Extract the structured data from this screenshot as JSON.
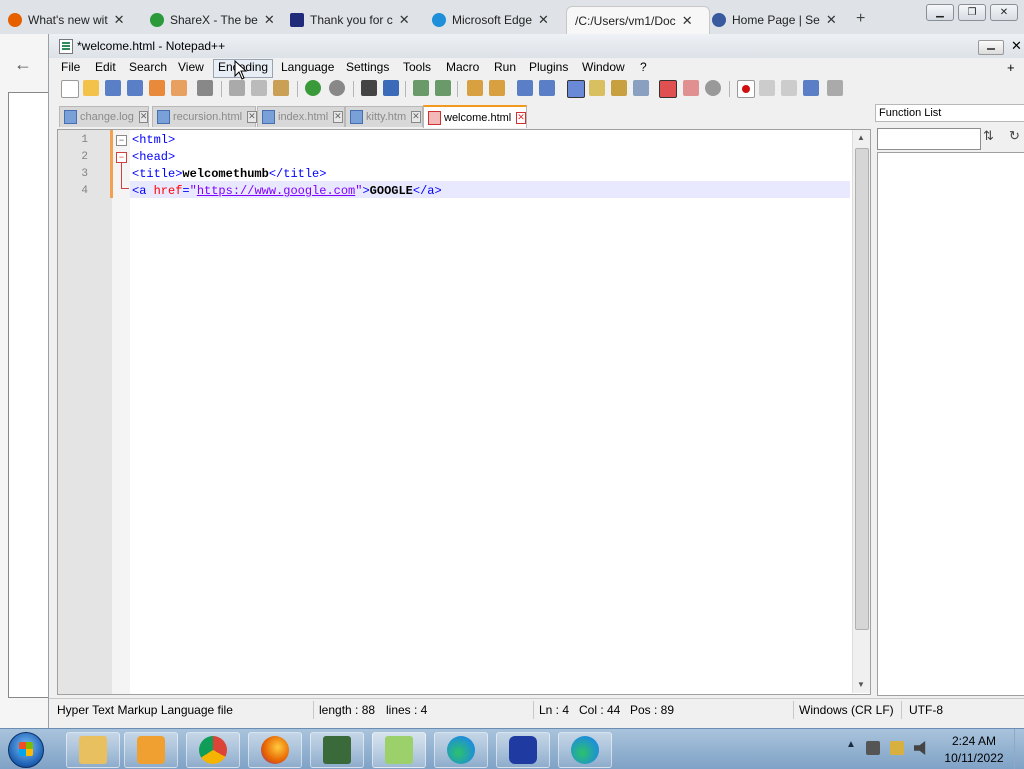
{
  "browser": {
    "tabs": [
      {
        "label": "What's new wit",
        "color": "#e66000"
      },
      {
        "label": "ShareX - The be",
        "color": "#2a9a3a"
      },
      {
        "label": "Thank you for c",
        "color": "#1f2a7a"
      },
      {
        "label": "Microsoft Edge",
        "color": "#1e8fd8"
      },
      {
        "label": "/C:/Users/vm1/Doc",
        "color": "#e0e0e0"
      },
      {
        "label": "Home Page | Se",
        "color": "#3a5aa0"
      }
    ],
    "new_tab": "+",
    "back": "←"
  },
  "window": {
    "title": "*welcome.html - Notepad++"
  },
  "menu": {
    "items": [
      "File",
      "Edit",
      "Search",
      "View",
      "Encoding",
      "Language",
      "Settings",
      "Tools",
      "Macro",
      "Run",
      "Plugins",
      "Window",
      "?"
    ],
    "plus": "+"
  },
  "doc_tabs": [
    {
      "label": "change.log",
      "active": false
    },
    {
      "label": "recursion.html",
      "active": false
    },
    {
      "label": "index.html",
      "active": false
    },
    {
      "label": "kitty.htm",
      "active": false
    },
    {
      "label": "welcome.html",
      "active": true
    }
  ],
  "editor": {
    "line_numbers": [
      "1",
      "2",
      "3",
      "4"
    ],
    "lines": [
      {
        "open": "<html>"
      },
      {
        "open": "<head>"
      },
      {
        "open": "<title>",
        "text": "welcomethumb",
        "close": "</title>"
      },
      {
        "tag_start": "<a ",
        "attr": "href",
        "eq": "=",
        "quote": "\"",
        "url": "https://www.google.com",
        "tag_end": ">",
        "text": "GOOGLE",
        "close": "</a>"
      }
    ]
  },
  "function_list": {
    "title": "Function List",
    "search_value": ""
  },
  "status": {
    "file_type": "Hyper Text Markup Language file",
    "length": "length : 88",
    "lines": "lines : 4",
    "ln": "Ln : 4",
    "col": "Col : 44",
    "pos": "Pos : 89",
    "eol": "Windows (CR LF)",
    "encoding": "UTF-8"
  },
  "taskbar": {
    "time": "2:24 AM",
    "date": "10/11/2022"
  }
}
